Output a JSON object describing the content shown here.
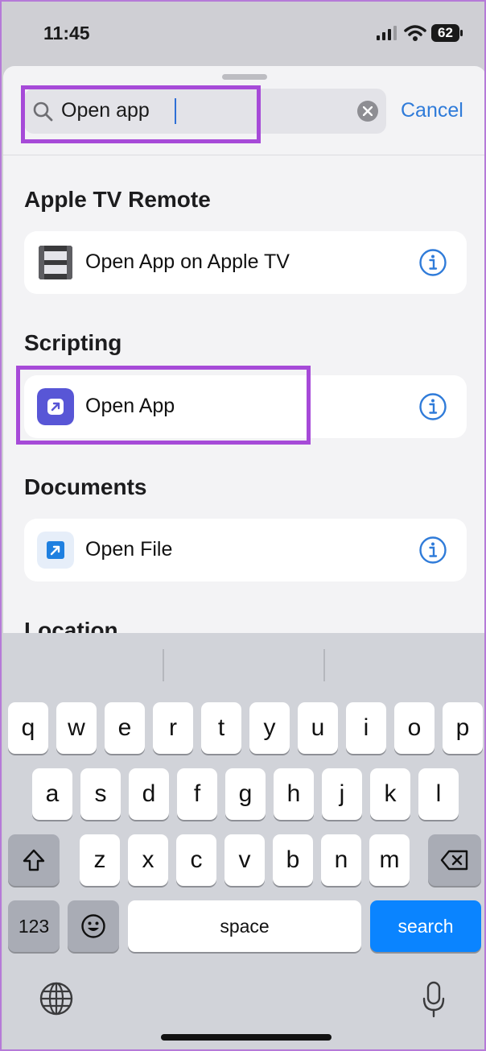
{
  "status_bar": {
    "time": "11:45",
    "battery": "62"
  },
  "search": {
    "value": "Open app",
    "cancel_label": "Cancel"
  },
  "sections": [
    {
      "title": "Apple TV Remote",
      "item_label": "Open App on Apple TV",
      "icon": "film-strip-icon"
    },
    {
      "title": "Scripting",
      "item_label": "Open App",
      "icon": "open-app-arrow-icon"
    },
    {
      "title": "Documents",
      "item_label": "Open File",
      "icon": "open-file-arrow-icon"
    },
    {
      "title": "Location"
    }
  ],
  "keyboard": {
    "row1": [
      "q",
      "w",
      "e",
      "r",
      "t",
      "y",
      "u",
      "i",
      "o",
      "p"
    ],
    "row2": [
      "a",
      "s",
      "d",
      "f",
      "g",
      "h",
      "j",
      "k",
      "l"
    ],
    "row3": [
      "z",
      "x",
      "c",
      "v",
      "b",
      "n",
      "m"
    ],
    "numbers_label": "123",
    "space_label": "space",
    "search_label": "search"
  },
  "colors": {
    "accent": "#2f7bd9",
    "highlight": "#a64ad8",
    "search_key": "#0a84ff",
    "scripting_icon": "#5856d6"
  }
}
